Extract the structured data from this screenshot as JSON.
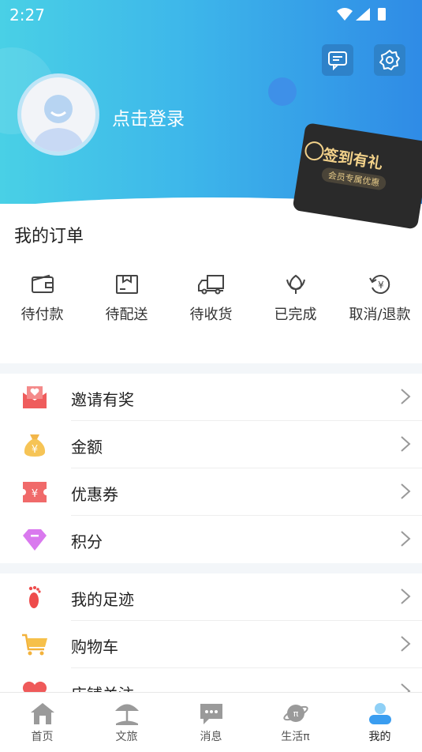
{
  "status": {
    "time": "2:27"
  },
  "header": {
    "login_text": "点击登录",
    "signin_badge": {
      "title": "签到有礼",
      "subtitle": "会员专属优惠"
    }
  },
  "orders": {
    "title": "我的订单",
    "items": [
      {
        "label": "待付款",
        "icon": "wallet-icon"
      },
      {
        "label": "待配送",
        "icon": "package-icon"
      },
      {
        "label": "待收货",
        "icon": "truck-icon"
      },
      {
        "label": "已完成",
        "icon": "flower-icon"
      },
      {
        "label": "取消/退款",
        "icon": "refund-icon"
      }
    ]
  },
  "menu_group1": [
    {
      "label": "邀请有奖",
      "icon": "envelope-heart-icon"
    },
    {
      "label": "金额",
      "icon": "money-bag-icon"
    },
    {
      "label": "优惠券",
      "icon": "coupon-icon"
    },
    {
      "label": "积分",
      "icon": "diamond-icon"
    }
  ],
  "menu_group2": [
    {
      "label": "我的足迹",
      "icon": "footprint-icon"
    },
    {
      "label": "购物车",
      "icon": "cart-icon"
    },
    {
      "label": "店铺关注",
      "icon": "heart-icon"
    }
  ],
  "tabbar": [
    {
      "label": "首页",
      "icon": "home-icon"
    },
    {
      "label": "文旅",
      "icon": "beach-umbrella-icon"
    },
    {
      "label": "消息",
      "icon": "message-icon"
    },
    {
      "label": "生活π",
      "icon": "planet-icon"
    },
    {
      "label": "我的",
      "icon": "person-icon",
      "active": true
    }
  ],
  "colors": {
    "accent": "#3db6ea",
    "active_tab": "#3a9df0"
  }
}
